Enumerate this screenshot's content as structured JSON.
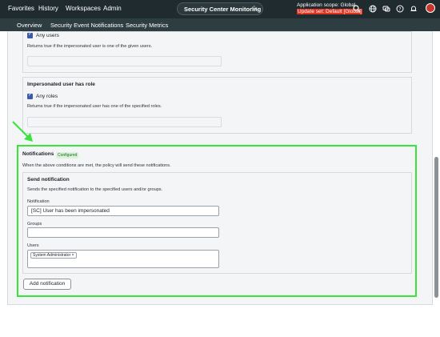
{
  "topnav": {
    "items": [
      "Favorites",
      "History",
      "Workspaces",
      "Admin"
    ],
    "app_title": "Security Center Monitoring",
    "scope_line": "Application scope: Global",
    "update_set_line": "Update set: Default [Global]"
  },
  "subnav": {
    "items": [
      "Overview",
      "Security Event Notifications",
      "Security Metrics"
    ]
  },
  "conditions": {
    "any_users_label": "Any users",
    "any_users_desc": "Returns true if the impersonated user is one of the given users.",
    "role_card_title": "Impersonated user has role",
    "any_roles_label": "Any roles",
    "any_roles_desc": "Returns true if the impersonated user has one of the specified roles."
  },
  "notifications": {
    "title": "Notifications",
    "badge": "Configured",
    "description": "When the above conditions are met, the policy will send these notifications.",
    "send_title": "Send notification",
    "send_desc": "Sends the specified notification to the specified users and/or groups.",
    "notification_label": "Notification",
    "notification_value": "[SC] User has been impersonated",
    "groups_label": "Groups",
    "users_label": "Users",
    "user_chip": "System Administrator",
    "chip_remove": "×",
    "add_button": "Add notification"
  },
  "icons": [
    "star-icon",
    "globe-icon",
    "chat-icon",
    "help-icon",
    "bell-icon",
    "avatar"
  ],
  "colors": {
    "topbar": "#1f2b2f",
    "highlight": "#39e53a",
    "checkbox": "#3d5ba8",
    "update_set_bg": "#e0331f"
  }
}
